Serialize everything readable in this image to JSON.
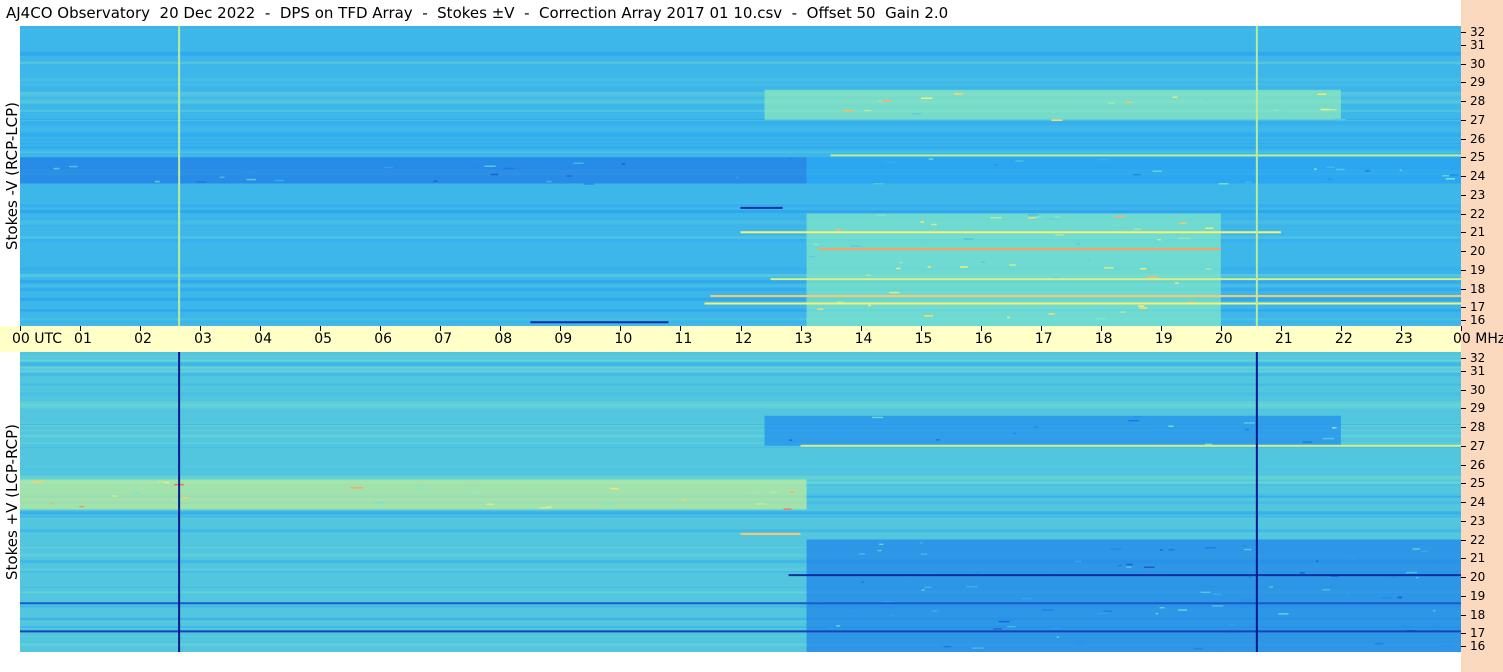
{
  "title": "AJ4CO Observatory  20 Dec 2022  -  DPS on TFD Array  -  Stokes ±V  -  Correction Array 2017 01 10.csv  -  Offset 50  Gain 2.0",
  "chart_data": [
    {
      "type": "heatmap",
      "panel": "top",
      "ylabel": "Stokes -V (RCP-LCP)",
      "y_unit": "MHz",
      "ylim": [
        16,
        32
      ],
      "y_ticks": [
        "32",
        "31",
        "30",
        "29",
        "28",
        "27",
        "26",
        "25",
        "24",
        "23",
        "22",
        "21",
        "20",
        "19",
        "18",
        "17",
        "16"
      ],
      "x_unit": "UTC",
      "xlim": [
        0,
        24
      ],
      "colormap": [
        "#0a1a8c",
        "#1d6fe0",
        "#27a6f5",
        "#7fe6c8",
        "#f8f070",
        "#ff5050"
      ],
      "background_level": 0.45,
      "features": [
        {
          "kind": "band",
          "y_range": [
            23.6,
            25.0
          ],
          "x_range": [
            0,
            13.1
          ],
          "level": 0.25
        },
        {
          "kind": "band",
          "y_range": [
            23.6,
            25.0
          ],
          "x_range": [
            13.1,
            24
          ],
          "level": 0.38
        },
        {
          "kind": "band",
          "y_range": [
            16.0,
            22.0
          ],
          "x_range": [
            13.1,
            20.0
          ],
          "level": 0.6
        },
        {
          "kind": "band",
          "y_range": [
            27.0,
            28.6
          ],
          "x_range": [
            12.4,
            22.0
          ],
          "level": 0.62
        },
        {
          "kind": "line",
          "y": 20.1,
          "x_range": [
            13.3,
            20.0
          ],
          "level": 0.9
        },
        {
          "kind": "line",
          "y": 17.6,
          "x_range": [
            11.5,
            24
          ],
          "level": 0.85
        },
        {
          "kind": "line",
          "y": 17.2,
          "x_range": [
            11.4,
            24
          ],
          "level": 0.8
        },
        {
          "kind": "line",
          "y": 18.5,
          "x_range": [
            12.5,
            24
          ],
          "level": 0.75
        },
        {
          "kind": "line",
          "y": 21.0,
          "x_range": [
            12.0,
            21.0
          ],
          "level": 0.8
        },
        {
          "kind": "line",
          "y": 25.1,
          "x_range": [
            13.5,
            24
          ],
          "level": 0.7
        },
        {
          "kind": "line",
          "y": 16.2,
          "x_range": [
            8.5,
            10.8
          ],
          "level": 0.05
        },
        {
          "kind": "line",
          "y": 22.3,
          "x_range": [
            12.0,
            12.7
          ],
          "level": 0.05
        },
        {
          "kind": "vline",
          "x": 2.65,
          "level": 0.7
        },
        {
          "kind": "vline",
          "x": 20.6,
          "level": 0.7
        }
      ]
    },
    {
      "type": "heatmap",
      "panel": "bottom",
      "ylabel": "Stokes +V (LCP-RCP)",
      "y_unit": "MHz",
      "ylim": [
        16,
        32
      ],
      "y_ticks": [
        "32",
        "31",
        "30",
        "29",
        "28",
        "27",
        "26",
        "25",
        "24",
        "23",
        "22",
        "21",
        "20",
        "19",
        "18",
        "17",
        "16"
      ],
      "x_unit": "UTC",
      "xlim": [
        0,
        24
      ],
      "colormap": [
        "#0a1a8c",
        "#1d6fe0",
        "#27a6f5",
        "#7fe6c8",
        "#f8f070",
        "#ff5050"
      ],
      "background_level": 0.5,
      "features": [
        {
          "kind": "band",
          "y_range": [
            23.6,
            25.2
          ],
          "x_range": [
            0,
            13.1
          ],
          "level": 0.7
        },
        {
          "kind": "band",
          "y_range": [
            16.0,
            22.0
          ],
          "x_range": [
            13.1,
            24
          ],
          "level": 0.28
        },
        {
          "kind": "band",
          "y_range": [
            27.0,
            28.6
          ],
          "x_range": [
            12.4,
            22.0
          ],
          "level": 0.32
        },
        {
          "kind": "line",
          "y": 20.1,
          "x_range": [
            12.8,
            24
          ],
          "level": 0.05
        },
        {
          "kind": "line",
          "y": 17.1,
          "x_range": [
            0,
            24
          ],
          "level": 0.1
        },
        {
          "kind": "line",
          "y": 18.6,
          "x_range": [
            0,
            24
          ],
          "level": 0.15
        },
        {
          "kind": "line",
          "y": 22.3,
          "x_range": [
            12.0,
            13.0
          ],
          "level": 0.85
        },
        {
          "kind": "line",
          "y": 27.0,
          "x_range": [
            13.0,
            24
          ],
          "level": 0.75
        },
        {
          "kind": "vline",
          "x": 2.65,
          "level": 0.0
        },
        {
          "kind": "vline",
          "x": 20.6,
          "level": 0.0
        }
      ]
    }
  ],
  "time_axis": {
    "labels": [
      "00  UTC",
      "01",
      "02",
      "03",
      "04",
      "05",
      "06",
      "07",
      "08",
      "09",
      "10",
      "11",
      "12",
      "13",
      "14",
      "15",
      "16",
      "17",
      "18",
      "19",
      "20",
      "21",
      "22",
      "23",
      "00  MHz"
    ]
  }
}
